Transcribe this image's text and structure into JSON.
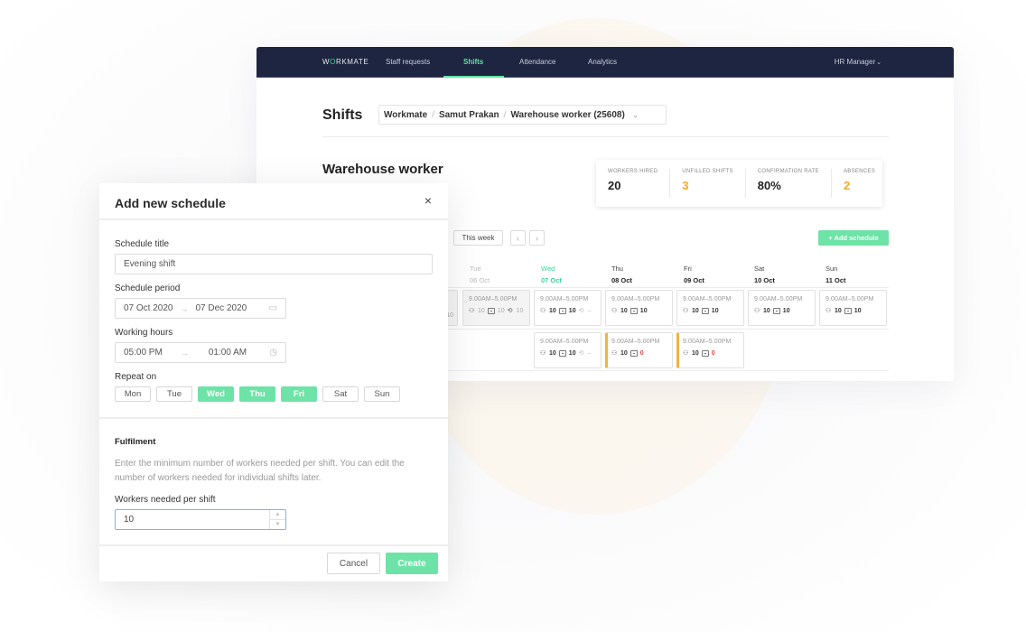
{
  "nav": {
    "logo": {
      "pre": "W",
      "o": "O",
      "post": "RKMATE"
    },
    "items": [
      {
        "label": "Staff requests",
        "active": false
      },
      {
        "label": "Shifts",
        "active": true
      },
      {
        "label": "Attendance",
        "active": false
      },
      {
        "label": "Analytics",
        "active": false
      }
    ],
    "user_menu": "HR Manager",
    "user_chevron": "⌄"
  },
  "header": {
    "title": "Shifts",
    "breadcrumb": [
      "Workmate",
      "Samut Prakan",
      "Warehouse worker (25608)"
    ],
    "breadcrumb_sep": "/",
    "breadcrumb_chevron": "⌄"
  },
  "role": {
    "title": "Warehouse worker"
  },
  "stats": [
    {
      "label": "WORKERS HIRED",
      "value": "20",
      "color": "#222222"
    },
    {
      "label": "UNFILLED SHIFTS",
      "value": "3",
      "color": "#f3a825"
    },
    {
      "label": "CONFIRMATION RATE",
      "value": "80%",
      "color": "#222222"
    },
    {
      "label": "ABSENCES",
      "value": "2",
      "color": "#f3a825"
    }
  ],
  "toolbar": {
    "this_week": "This week",
    "prev": "‹",
    "next": "›",
    "add_schedule": "+ Add schedule"
  },
  "days": [
    {
      "name": "Tue",
      "date": "06 Oct",
      "state": "past"
    },
    {
      "name": "Wed",
      "date": "07 Oct",
      "state": "today"
    },
    {
      "name": "Thu",
      "date": "08 Oct",
      "state": "future"
    },
    {
      "name": "Fri",
      "date": "09 Oct",
      "state": "future"
    },
    {
      "name": "Sat",
      "date": "10 Oct",
      "state": "future"
    },
    {
      "name": "Sun",
      "date": "11 Oct",
      "state": "future"
    }
  ],
  "shifts": {
    "row1": [
      {
        "time": "9.00AM–5.00PM",
        "workers": "10",
        "confirmed": "10",
        "checkin": "10",
        "past": true
      },
      {
        "time": "9.00AM–5.00PM",
        "workers": "10",
        "confirmed": "10",
        "checkin": "–",
        "past": false
      },
      {
        "time": "9.00AM–5.00PM",
        "workers": "10",
        "confirmed": "10",
        "past": false
      },
      {
        "time": "9.00AM–5.00PM",
        "workers": "10",
        "confirmed": "10",
        "past": false
      },
      {
        "time": "9.00AM–5.00PM",
        "workers": "10",
        "confirmed": "10",
        "past": false
      },
      {
        "time": "9.00AM–5.00PM",
        "workers": "10",
        "confirmed": "10",
        "past": false
      }
    ],
    "row2": [
      {
        "time": "9.00AM–5.00PM",
        "workers": "10",
        "confirmed": "10",
        "checkin": "–",
        "alert": false
      },
      {
        "time": "9.00AM–5.00PM",
        "workers": "10",
        "confirmed": "0",
        "alert": true
      },
      {
        "time": "9.00AM–5.00PM",
        "workers": "10",
        "confirmed": "0",
        "alert": true
      }
    ],
    "hidden_mon_checkin": "10"
  },
  "modal": {
    "title": "Add new schedule",
    "close": "×",
    "schedule_title_label": "Schedule title",
    "schedule_title_value": "Evening shift",
    "period_label": "Schedule period",
    "period_start": "07 Oct 2020",
    "period_end": "07 Dec 2020",
    "hours_label": "Working hours",
    "hours_start": "05:00 PM",
    "hours_end": "01:00 AM",
    "arrow": "→",
    "repeat_label": "Repeat on",
    "repeat_days": [
      {
        "label": "Mon",
        "on": false
      },
      {
        "label": "Tue",
        "on": false
      },
      {
        "label": "Wed",
        "on": true
      },
      {
        "label": "Thu",
        "on": true
      },
      {
        "label": "Fri",
        "on": true
      },
      {
        "label": "Sat",
        "on": false
      },
      {
        "label": "Sun",
        "on": false
      }
    ],
    "fulfilment_title": "Fulfilment",
    "fulfilment_help": "Enter the minimum number of workers needed per shift. You can edit the number of workers needed for individual shifts later.",
    "workers_label": "Workers needed per shift",
    "workers_value": "10",
    "cancel": "Cancel",
    "create": "Create"
  },
  "colors": {
    "accent": "#6ee3a7",
    "nav_bg": "#1e2540",
    "warning": "#f3a825",
    "danger": "#ee4040"
  }
}
